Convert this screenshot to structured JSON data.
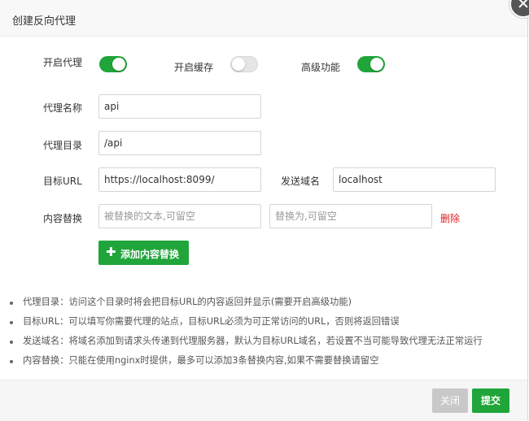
{
  "dialog": {
    "title": "创建反向代理"
  },
  "toggles": {
    "proxy_enable": {
      "label": "开启代理",
      "on": true
    },
    "cache_enable": {
      "label": "开启缓存",
      "on": false
    },
    "advanced": {
      "label": "高级功能",
      "on": true
    }
  },
  "form": {
    "proxy_name": {
      "label": "代理名称",
      "value": "api"
    },
    "proxy_dir": {
      "label": "代理目录",
      "value": "/api"
    },
    "target_url": {
      "label": "目标URL",
      "value": "https://localhost:8099/"
    },
    "send_domain": {
      "label": "发送域名",
      "value": "localhost"
    },
    "content_replace": {
      "label": "内容替换",
      "from_placeholder": "被替换的文本,可留空",
      "to_placeholder": "替换为,可留空",
      "delete_label": "删除"
    },
    "add_replace_label": "添加内容替换"
  },
  "notes": [
    "代理目录：访问这个目录时将会把目标URL的内容返回并显示(需要开启高级功能)",
    "目标URL：可以填写你需要代理的站点，目标URL必须为可正常访问的URL，否则将返回错误",
    "发送域名：将域名添加到请求头传递到代理服务器，默认为目标URL域名，若设置不当可能导致代理无法正常运行",
    "内容替换：只能在使用nginx时提供，最多可以添加3条替换内容,如果不需要替换请留空"
  ],
  "footer": {
    "close_label": "关闭",
    "submit_label": "提交"
  },
  "colors": {
    "accent": "#20a53a",
    "danger": "#e02020",
    "disabled": "#c8c8c8"
  },
  "icons": {
    "close": "close-icon",
    "add": "plus-icon"
  }
}
